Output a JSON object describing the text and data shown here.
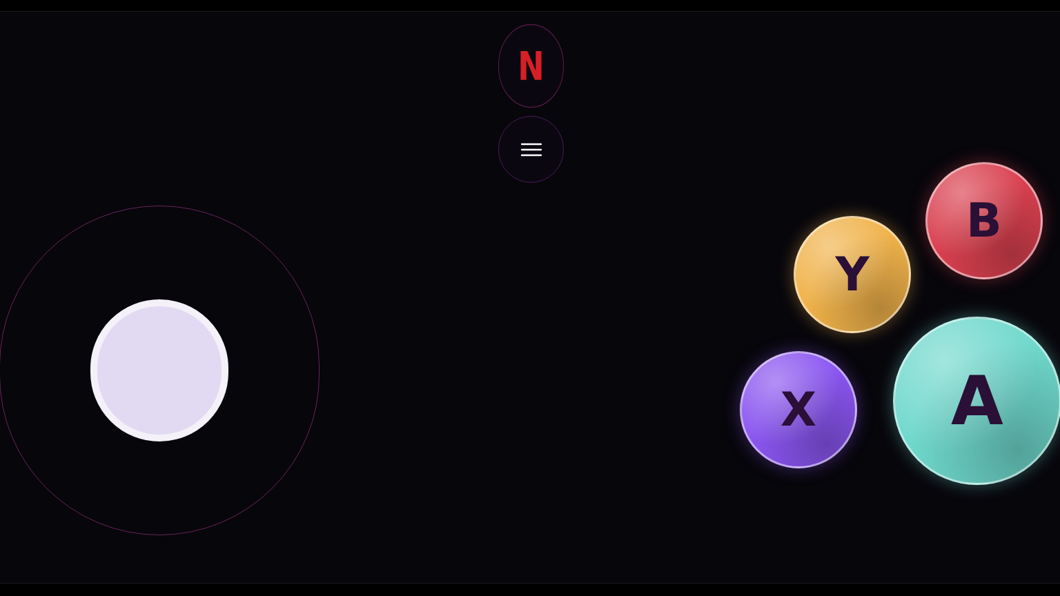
{
  "logo_button": {
    "text": "N"
  },
  "face_buttons": [
    {
      "label": "B",
      "color": "#d9404f"
    },
    {
      "label": "Y",
      "color": "#f0b24a"
    },
    {
      "label": "X",
      "color": "#8a55f0"
    },
    {
      "label": "A",
      "color": "#6fd8cc"
    }
  ]
}
